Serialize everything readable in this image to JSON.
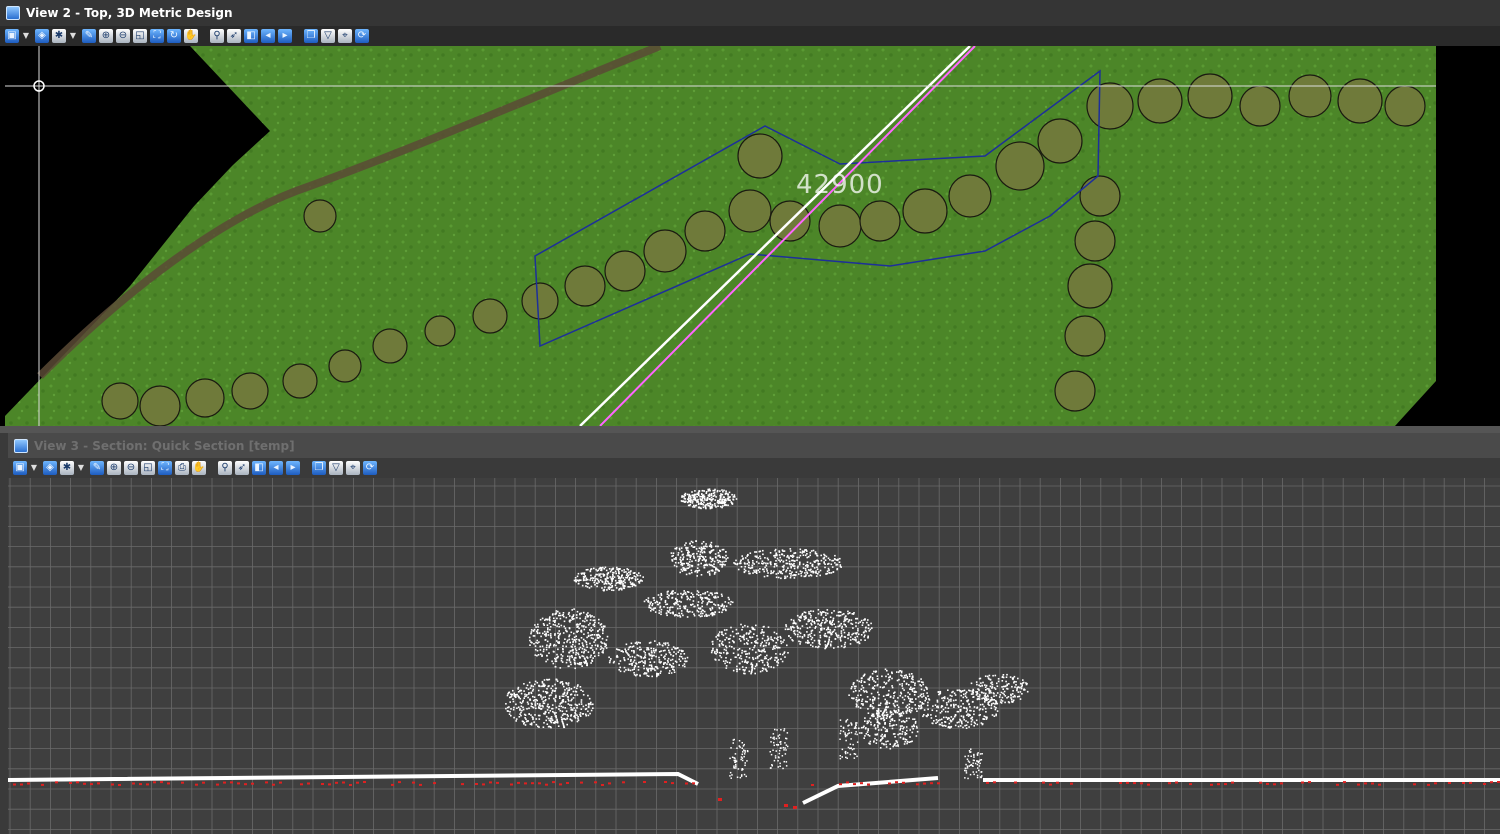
{
  "view2": {
    "title": "View 2 - Top, 3D Metric Design",
    "station_label": "42900"
  },
  "view3": {
    "title": "View 3 - Section: Quick Section [temp]"
  },
  "toolbar_icons": [
    "view-icon",
    "dropdown-icon",
    "layers-icon",
    "light-icon",
    "dropdown-icon",
    "pen-icon",
    "zoom-in-icon",
    "zoom-out-icon",
    "zoom-window-icon",
    "zoom-extents-icon",
    "rotate-icon",
    "pan-icon",
    "walk-icon",
    "fly-icon",
    "clip-icon",
    "section-prev-icon",
    "section-next-icon",
    "copy-view-icon",
    "filter-icon",
    "select-icon",
    "refresh-icon"
  ],
  "colors": {
    "grass": "#4f8a2a",
    "trees": "#6f7a3a",
    "section_points": "#ffffff",
    "ground_points": "#e02020",
    "alignment_line": "#ff66ff",
    "boundary": "#1d2f9a"
  }
}
